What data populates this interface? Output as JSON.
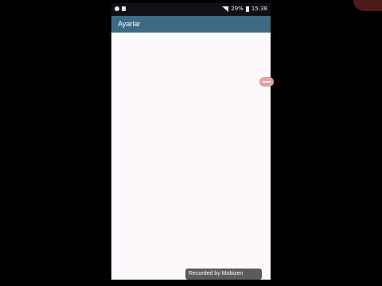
{
  "status_bar": {
    "signal_text": "29%",
    "time": "15:38"
  },
  "app_bar": {
    "title": "Ayarlar"
  },
  "watermark": {
    "text": "Recorded by",
    "brand": "Mobizen"
  },
  "colors": {
    "app_bar": "#3d6a85",
    "status_bar": "#0f1114",
    "background": "#fcf8fc",
    "fab": "#e8a0a0"
  },
  "icons": [
    "notification-icon",
    "sim-icon",
    "signal-icon",
    "battery-icon",
    "record-icon"
  ]
}
